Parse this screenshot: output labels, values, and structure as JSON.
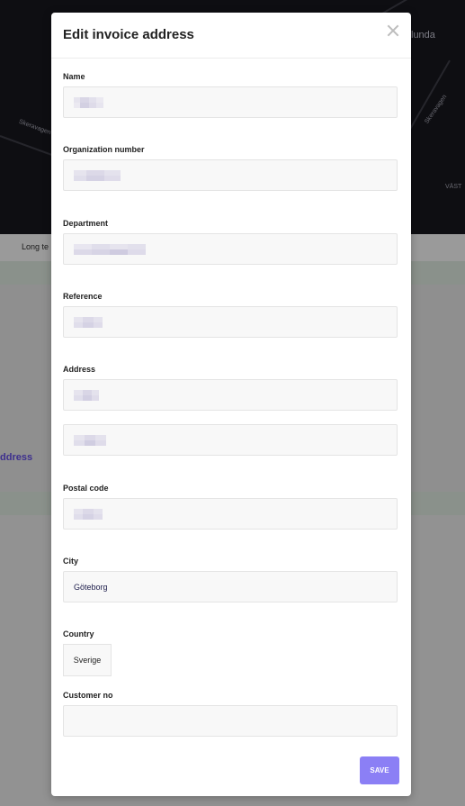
{
  "background": {
    "map_labels": [
      "lunda",
      "Skeravagen",
      "Skeravagen",
      "VÄST"
    ],
    "tab_text": "Long te",
    "link_text": "ddress"
  },
  "modal": {
    "title": "Edit invoice address",
    "fields": {
      "name_label": "Name",
      "org_label": "Organization number",
      "department_label": "Department",
      "reference_label": "Reference",
      "address_label": "Address",
      "postal_label": "Postal code",
      "city_label": "City",
      "city_value": "Göteborg",
      "country_label": "Country",
      "country_value": "Sverige",
      "customer_label": "Customer no",
      "customer_value": ""
    },
    "save_label": "SAVE"
  },
  "colors": {
    "accent": "#8b7ff5",
    "overlay": "#8f8f8f"
  }
}
